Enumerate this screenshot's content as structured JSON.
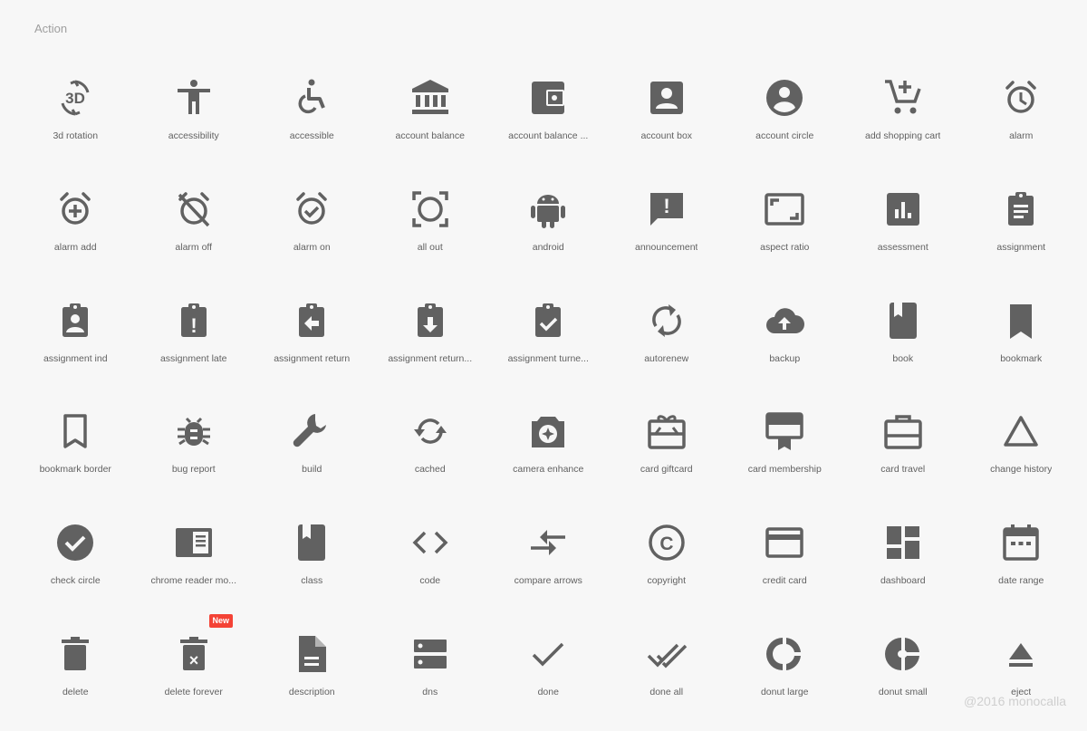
{
  "section": {
    "title": "Action"
  },
  "colors": {
    "icon": "#616161",
    "label": "#616161",
    "title": "#9e9e9e",
    "badge": "#f44336",
    "background": "#f7f7f7"
  },
  "icons": [
    {
      "label": "3d rotation",
      "icon": "3d-rotation-icon",
      "glyph": "3D"
    },
    {
      "label": "accessibility",
      "icon": "accessibility-icon"
    },
    {
      "label": "accessible",
      "icon": "accessible-icon"
    },
    {
      "label": "account balance",
      "icon": "account-balance-icon"
    },
    {
      "label": "account balance ...",
      "icon": "account-balance-wallet-icon"
    },
    {
      "label": "account box",
      "icon": "account-box-icon"
    },
    {
      "label": "account circle",
      "icon": "account-circle-icon"
    },
    {
      "label": "add shopping cart",
      "icon": "add-shopping-cart-icon"
    },
    {
      "label": "alarm",
      "icon": "alarm-icon"
    },
    {
      "label": "alarm add",
      "icon": "alarm-add-icon"
    },
    {
      "label": "alarm off",
      "icon": "alarm-off-icon"
    },
    {
      "label": "alarm on",
      "icon": "alarm-on-icon"
    },
    {
      "label": "all out",
      "icon": "all-out-icon"
    },
    {
      "label": "android",
      "icon": "android-icon"
    },
    {
      "label": "announcement",
      "icon": "announcement-icon",
      "glyph": "!"
    },
    {
      "label": "aspect ratio",
      "icon": "aspect-ratio-icon"
    },
    {
      "label": "assessment",
      "icon": "assessment-icon"
    },
    {
      "label": "assignment",
      "icon": "assignment-icon"
    },
    {
      "label": "assignment ind",
      "icon": "assignment-ind-icon"
    },
    {
      "label": "assignment late",
      "icon": "assignment-late-icon",
      "glyph": "!"
    },
    {
      "label": "assignment return",
      "icon": "assignment-return-icon"
    },
    {
      "label": "assignment return...",
      "icon": "assignment-returned-icon"
    },
    {
      "label": "assignment turne...",
      "icon": "assignment-turned-in-icon"
    },
    {
      "label": "autorenew",
      "icon": "autorenew-icon"
    },
    {
      "label": "backup",
      "icon": "backup-icon"
    },
    {
      "label": "book",
      "icon": "book-icon"
    },
    {
      "label": "bookmark",
      "icon": "bookmark-icon"
    },
    {
      "label": "bookmark border",
      "icon": "bookmark-border-icon"
    },
    {
      "label": "bug report",
      "icon": "bug-report-icon"
    },
    {
      "label": "build",
      "icon": "build-icon"
    },
    {
      "label": "cached",
      "icon": "cached-icon"
    },
    {
      "label": "camera enhance",
      "icon": "camera-enhance-icon"
    },
    {
      "label": "card giftcard",
      "icon": "card-giftcard-icon"
    },
    {
      "label": "card membership",
      "icon": "card-membership-icon"
    },
    {
      "label": "card travel",
      "icon": "card-travel-icon"
    },
    {
      "label": "change history",
      "icon": "change-history-icon"
    },
    {
      "label": "check circle",
      "icon": "check-circle-icon"
    },
    {
      "label": "chrome reader mo...",
      "icon": "chrome-reader-mode-icon"
    },
    {
      "label": "class",
      "icon": "class-icon"
    },
    {
      "label": "code",
      "icon": "code-icon"
    },
    {
      "label": "compare arrows",
      "icon": "compare-arrows-icon"
    },
    {
      "label": "copyright",
      "icon": "copyright-icon",
      "glyph": "C"
    },
    {
      "label": "credit card",
      "icon": "credit-card-icon"
    },
    {
      "label": "dashboard",
      "icon": "dashboard-icon"
    },
    {
      "label": "date range",
      "icon": "date-range-icon"
    },
    {
      "label": "delete",
      "icon": "delete-icon"
    },
    {
      "label": "delete forever",
      "icon": "delete-forever-icon",
      "badge": "New",
      "glyph": "×"
    },
    {
      "label": "description",
      "icon": "description-icon"
    },
    {
      "label": "dns",
      "icon": "dns-icon"
    },
    {
      "label": "done",
      "icon": "done-icon"
    },
    {
      "label": "done all",
      "icon": "done-all-icon"
    },
    {
      "label": "donut large",
      "icon": "donut-large-icon"
    },
    {
      "label": "donut small",
      "icon": "donut-small-icon"
    },
    {
      "label": "eject",
      "icon": "eject-icon"
    }
  ],
  "watermark": "@2016 monocalla"
}
